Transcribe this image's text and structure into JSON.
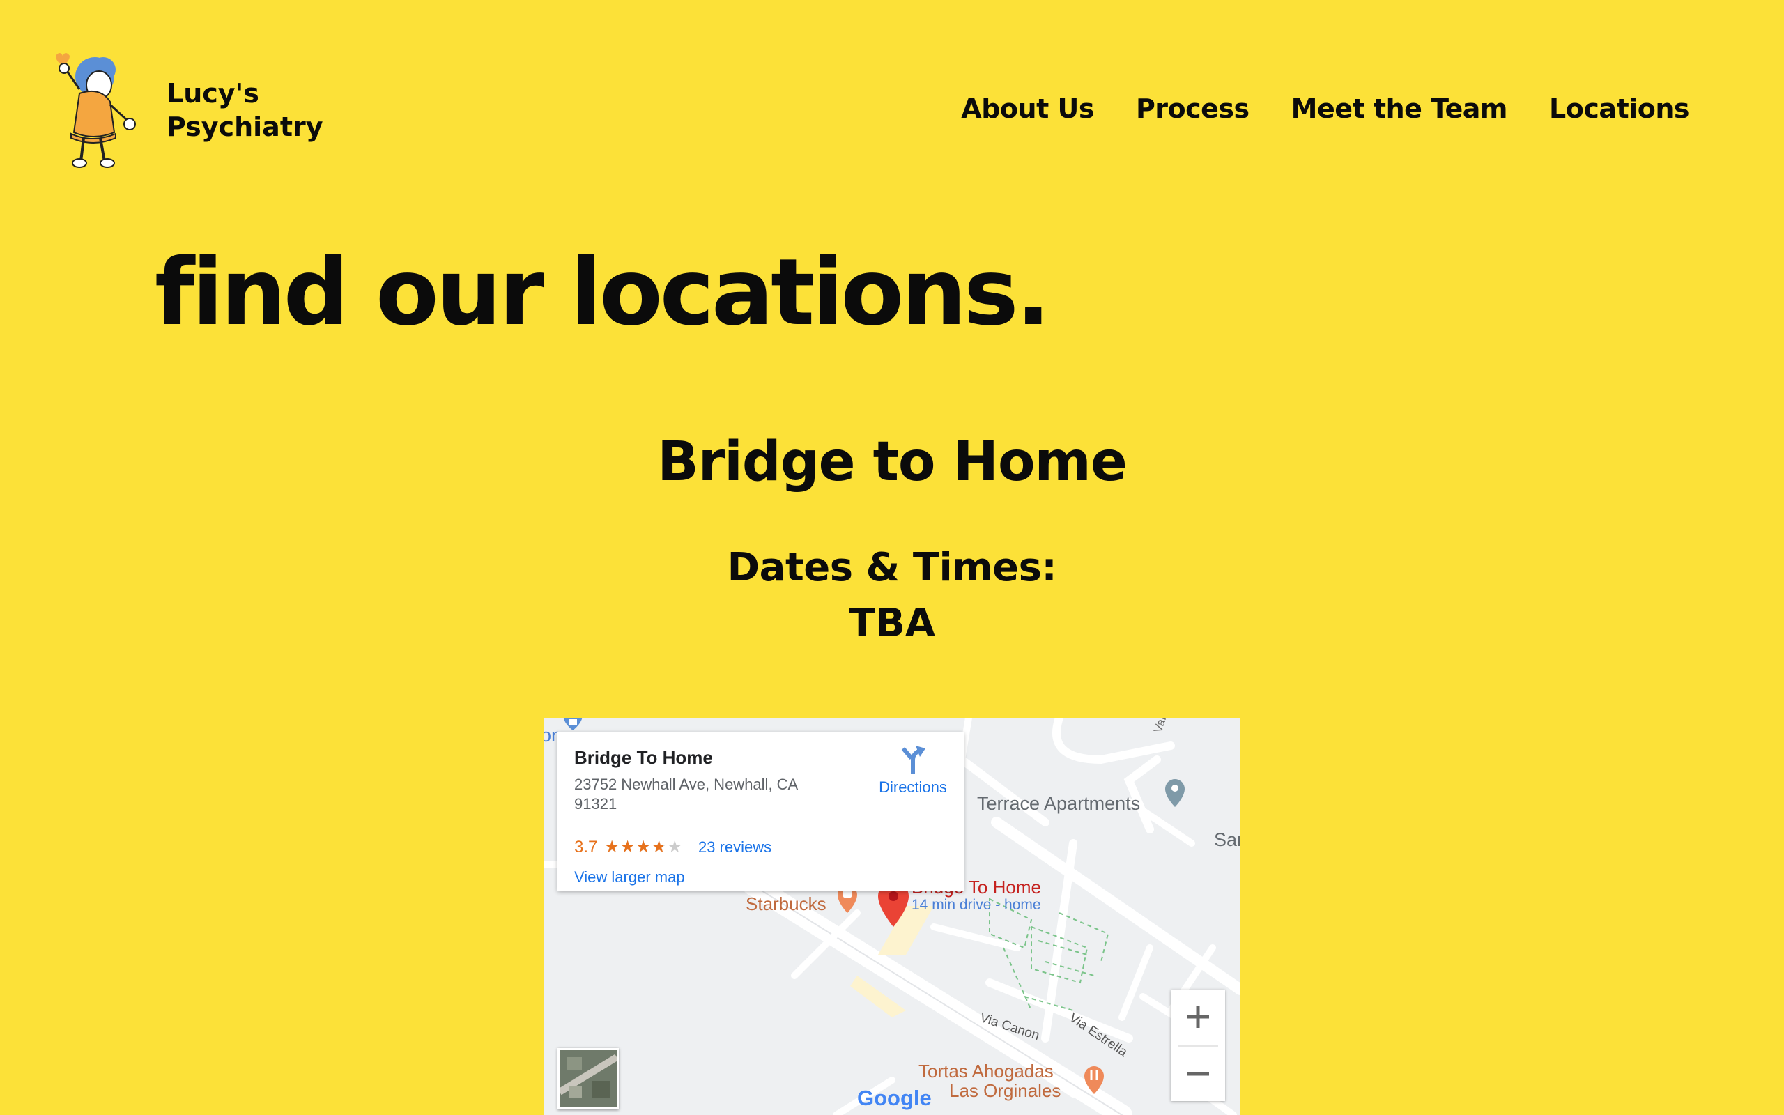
{
  "brand": {
    "line1": "Lucy's",
    "line2": "Psychiatry"
  },
  "nav": [
    {
      "label": "About Us"
    },
    {
      "label": "Process"
    },
    {
      "label": "Meet the Team"
    },
    {
      "label": "Locations"
    }
  ],
  "page": {
    "title": "find our locations.",
    "location_name": "Bridge to Home",
    "dates_label": "Dates & Times:",
    "dates_value": "TBA"
  },
  "map": {
    "place_name": "Bridge To Home",
    "address": "23752 Newhall Ave, Newhall, CA 91321",
    "rating": "3.7",
    "rating_fraction": 0.74,
    "reviews": "23 reviews",
    "directions": "Directions",
    "view_larger": "View larger map",
    "labels": {
      "terrace": "Terrace Apartments",
      "sar": "Sar",
      "starbucks": "Starbucks",
      "pin_title": "Bridge To Home",
      "pin_sub": "14 min drive - home",
      "via_canon": "Via Canon",
      "via_estrella": "Via Estrella",
      "tortas_1": "Tortas Ahogadas",
      "tortas_2": "Las Orginales",
      "google": "Google",
      "partial_left": "on",
      "valle": "Valle D"
    },
    "zoom_in": "+",
    "zoom_out": "−"
  },
  "colors": {
    "background": "#fce138",
    "text": "#0b0b0b",
    "link": "#1a73e8",
    "rating": "#e7711b",
    "pin": "#ea4335"
  },
  "icons": [
    "lucy-mascot-icon",
    "directions-icon",
    "map-pin-icon",
    "starbucks-cup-icon",
    "restaurant-icon",
    "place-marker-icon",
    "shopping-icon",
    "star-icon",
    "zoom-in-icon",
    "zoom-out-icon"
  ]
}
